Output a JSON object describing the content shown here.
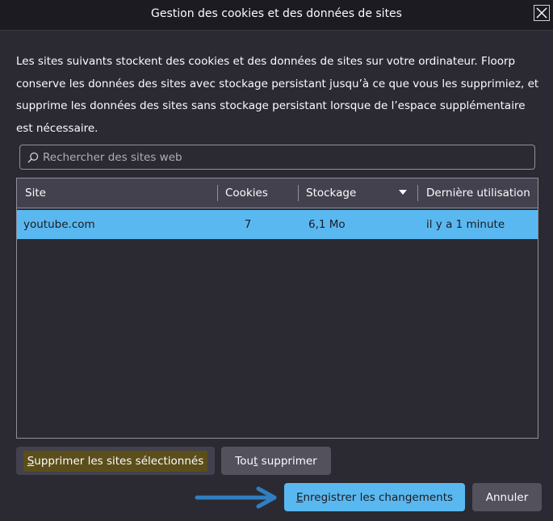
{
  "dialog": {
    "title": "Gestion des cookies et des données de sites",
    "description": "Les sites suivants stockent des cookies et des données de sites sur votre ordinateur. Floorp conserve les données des sites avec stockage persistant jusqu’à ce que vous les supprimiez, et supprime les données des sites sans stockage persistant lorsque de l’espace supplémentaire est nécessaire."
  },
  "search": {
    "placeholder": "Rechercher des sites web",
    "value": ""
  },
  "table": {
    "columns": [
      "Site",
      "Cookies",
      "Stockage",
      "Dernière utilisation"
    ],
    "sorted_column": "Stockage",
    "sort_direction": "descending",
    "rows": [
      {
        "site": "youtube.com",
        "cookies": "7",
        "storage": "6,1 Mo",
        "last_used": "il y a 1 minute",
        "selected": true
      }
    ]
  },
  "buttons": {
    "delete_selected_access": "S",
    "delete_selected_rest": "upprimer les sites sélectionnés",
    "delete_all_pre": "Tou",
    "delete_all_access": "t",
    "delete_all_post": " supprimer",
    "save_access": "E",
    "save_rest": "nregistrer les changements",
    "cancel": "Annuler"
  },
  "colors": {
    "background": "#2b2a33",
    "header": "#42414d",
    "accent": "#5ab8f0",
    "focus_highlight": "#5a4e1a",
    "annotation_arrow": "#2f7fc1"
  },
  "icons": {
    "close": "close-icon",
    "search": "search-icon",
    "sort": "sort-descending-icon",
    "annotation": "arrow-right-icon"
  }
}
